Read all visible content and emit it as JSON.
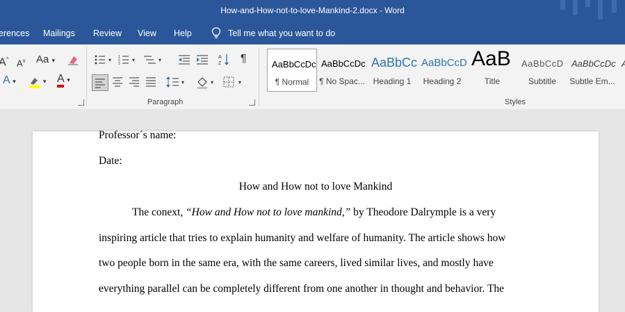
{
  "window": {
    "title": "How-and-How-not-to-love-Mankind-2.docx  -  Word"
  },
  "tabs": [
    "erences",
    "Mailings",
    "Review",
    "View",
    "Help"
  ],
  "tell_me": {
    "label": "Tell me what you want to do",
    "icon": "lightbulb-icon"
  },
  "ribbon": {
    "font_group": {
      "tools": [
        "A",
        "A",
        "Aa",
        "A",
        "A"
      ]
    },
    "paragraph_group": {
      "label": "Paragraph",
      "show_marks": "¶"
    },
    "styles_group": {
      "label": "Styles",
      "styles": [
        {
          "preview": "AaBbCcDc",
          "label": "¶ Normal",
          "selected": true,
          "color": "#000000"
        },
        {
          "preview": "AaBbCcDc",
          "label": "¶ No Spac...",
          "selected": false,
          "color": "#000000"
        },
        {
          "preview": "AaBbCc",
          "label": "Heading 1",
          "selected": false,
          "color": "#2e74b5"
        },
        {
          "preview": "AaBbCcD",
          "label": "Heading 2",
          "selected": false,
          "color": "#2e74b5"
        },
        {
          "preview": "AaB",
          "label": "Title",
          "selected": false,
          "color": "#000000"
        },
        {
          "preview": "AaBbCcD",
          "label": "Subtitle",
          "selected": false,
          "color": "#595959"
        },
        {
          "preview": "AaBbCcDc",
          "label": "Subtle Em...",
          "selected": false,
          "color": "#404040"
        },
        {
          "preview": "A",
          "label": "",
          "selected": false,
          "color": "#404040"
        }
      ]
    }
  },
  "document": {
    "professor_line": "Professor´s name:",
    "date_line": "Date:",
    "title": "How and How not to love Mankind",
    "para1": {
      "start": "The conext, ",
      "italic": "“How and How not to love mankind,”",
      "rest": " by Theodore Dalrymple is a very"
    },
    "line2": "inspiring article that tries to explain humanity and welfare of humanity. The article shows how",
    "line3": "two people born in the same era, with the same careers, lived similar lives, and mostly have",
    "line4": "everything parallel can be completely different from one another in thought and behavior. The"
  }
}
